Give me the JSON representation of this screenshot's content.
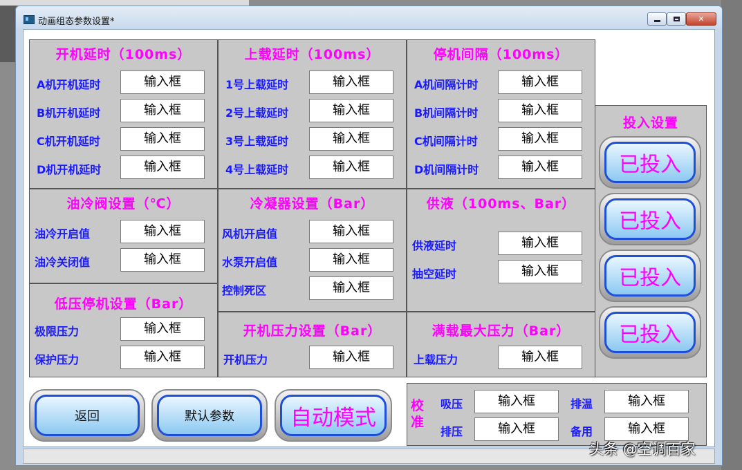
{
  "window": {
    "title": "动画组态参数设置*",
    "minimize_label": "",
    "maximize_label": "",
    "close_label": "✕"
  },
  "panels": {
    "startup_delay": {
      "title": "开机延时（100ms）",
      "rows": [
        {
          "label": "A机开机延时",
          "value": "输入框"
        },
        {
          "label": "B机开机延时",
          "value": "输入框"
        },
        {
          "label": "C机开机延时",
          "value": "输入框"
        },
        {
          "label": "D机开机延时",
          "value": "输入框"
        }
      ]
    },
    "load_delay": {
      "title": "上载延时（100ms）",
      "rows": [
        {
          "label": "1号上载延时",
          "value": "输入框"
        },
        {
          "label": "2号上载延时",
          "value": "输入框"
        },
        {
          "label": "3号上载延时",
          "value": "输入框"
        },
        {
          "label": "4号上载延时",
          "value": "输入框"
        }
      ]
    },
    "stop_interval": {
      "title": "停机间隔（100ms）",
      "rows": [
        {
          "label": "A机间隔计时",
          "value": "输入框"
        },
        {
          "label": "B机间隔计时",
          "value": "输入框"
        },
        {
          "label": "C机间隔计时",
          "value": "输入框"
        },
        {
          "label": "D机间隔计时",
          "value": "输入框"
        }
      ]
    },
    "oil_cooling": {
      "title": "油冷阀设置（℃）",
      "rows": [
        {
          "label": "油冷开启值",
          "value": "输入框"
        },
        {
          "label": "油冷关闭值",
          "value": "输入框"
        }
      ]
    },
    "condenser": {
      "title": "冷凝器设置（Bar）",
      "rows": [
        {
          "label": "风机开启值",
          "value": "输入框"
        },
        {
          "label": "水泵开启值",
          "value": "输入框"
        },
        {
          "label": "控制死区",
          "value": "输入框"
        }
      ]
    },
    "liquid_supply": {
      "title": "供液（100ms、Bar）",
      "rows": [
        {
          "label": "供液延时",
          "value": "输入框"
        },
        {
          "label": "抽空延时",
          "value": "输入框"
        }
      ]
    },
    "low_pressure_stop": {
      "title": "低压停机设置（Bar）",
      "rows": [
        {
          "label": "极限压力",
          "value": "输入框"
        },
        {
          "label": "保护压力",
          "value": "输入框"
        }
      ]
    },
    "startup_pressure": {
      "title": "开机压力设置（Bar）",
      "rows": [
        {
          "label": "开机压力",
          "value": "输入框"
        }
      ]
    },
    "full_load_pressure": {
      "title": "满载最大压力（Bar）",
      "rows": [
        {
          "label": "上载压力",
          "value": "输入框"
        }
      ]
    },
    "enable_settings": {
      "title": "投入设置",
      "buttons": [
        "已投入",
        "已投入",
        "已投入",
        "已投入"
      ]
    },
    "calibration": {
      "title": "校准",
      "rows": [
        {
          "label": "吸压",
          "value": "输入框"
        },
        {
          "label": "排温",
          "value": "输入框"
        },
        {
          "label": "排压",
          "value": "输入框"
        },
        {
          "label": "备用",
          "value": "输入框"
        }
      ]
    }
  },
  "bottom_buttons": {
    "back": "返回",
    "default_params": "默认参数",
    "auto_mode": "自动模式"
  },
  "watermark": "头条 @空调百家",
  "colors": {
    "title_pink": "#ff00ff",
    "label_blue": "#1a1aff",
    "button_border_blue": "#1d4fd8",
    "panel_gray": "#c8c8c8"
  }
}
